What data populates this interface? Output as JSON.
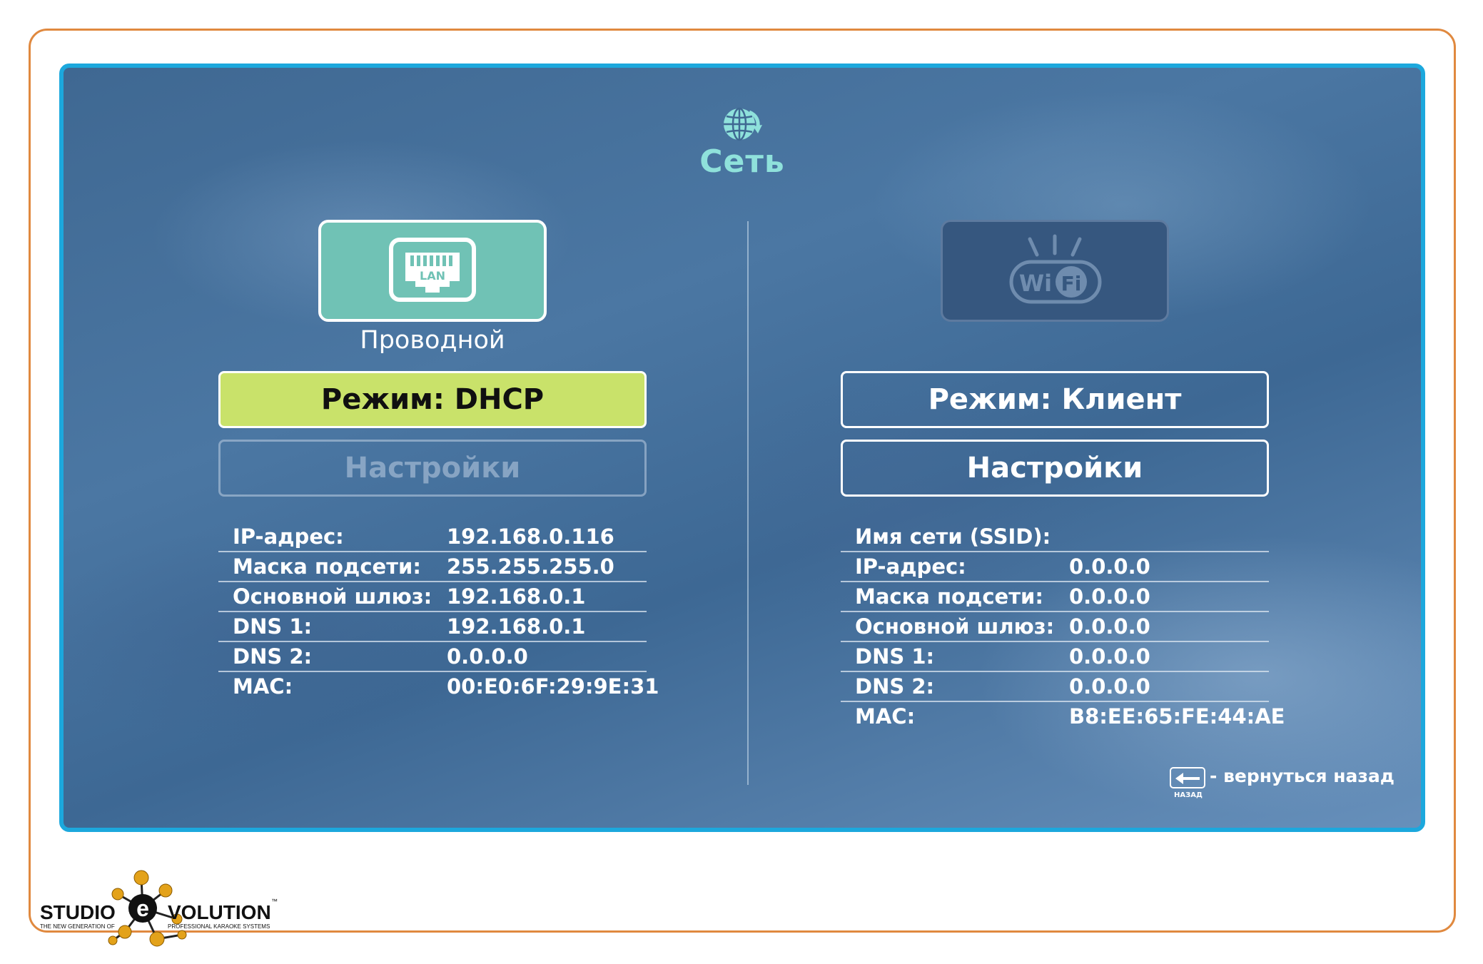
{
  "header": {
    "title": "Сеть",
    "icon": "globe-refresh-icon"
  },
  "wired": {
    "icon": "lan-port-icon",
    "icon_label": "LAN",
    "caption": "Проводной",
    "mode_button": "Режим: DHCP",
    "settings_button": "Настройки",
    "rows": [
      {
        "label": "IP-адрес:",
        "value": "192.168.0.116"
      },
      {
        "label": "Маска подсети:",
        "value": "255.255.255.0"
      },
      {
        "label": "Основной шлюз:",
        "value": "192.168.0.1"
      },
      {
        "label": "DNS 1:",
        "value": "192.168.0.1"
      },
      {
        "label": "DNS 2:",
        "value": "0.0.0.0"
      },
      {
        "label": "MAC:",
        "value": "00:E0:6F:29:9E:31"
      }
    ]
  },
  "wireless": {
    "icon": "wifi-icon",
    "icon_label_left": "Wi",
    "icon_label_right": "Fi",
    "mode_button": "Режим: Клиент",
    "settings_button": "Настройки",
    "rows": [
      {
        "label": "Имя сети (SSID):",
        "value": ""
      },
      {
        "label": "IP-адрес:",
        "value": "0.0.0.0"
      },
      {
        "label": "Маска подсети:",
        "value": "0.0.0.0"
      },
      {
        "label": "Основной шлюз:",
        "value": "0.0.0.0"
      },
      {
        "label": "DNS 1:",
        "value": "0.0.0.0"
      },
      {
        "label": "DNS 2:",
        "value": "0.0.0.0"
      },
      {
        "label": "MAC:",
        "value": "B8:EE:65:FE:44:AE"
      }
    ]
  },
  "footer_hint": {
    "key_icon": "back-arrow-icon",
    "key_label": "НАЗАД",
    "text": "- вернуться назад"
  },
  "logo": {
    "left_word": "STUDIO",
    "right_word": "VOLUTION",
    "center_letter": "e",
    "tagline_left": "THE NEW GENERATION OF",
    "tagline_right": "PROFESSIONAL KARAOKE SYSTEMS",
    "trademark": "™"
  },
  "colors": {
    "frame_orange": "#e0893f",
    "screen_border": "#1ca8dd",
    "title_teal": "#8fe1db",
    "lan_tile": "#70c2b5",
    "mode_highlight": "#c9e26a",
    "logo_gold": "#e3a21a"
  }
}
